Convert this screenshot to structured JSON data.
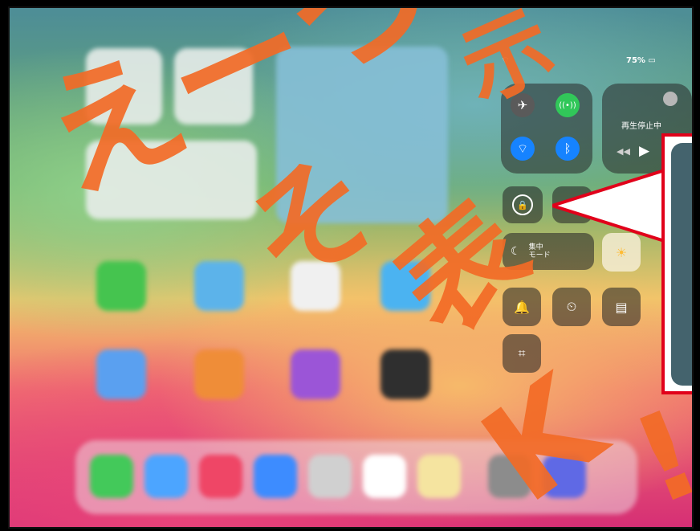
{
  "status_bar": {
    "battery": "75%"
  },
  "control_center": {
    "media_label": "再生停止中",
    "focus_label": "集中\nモード"
  },
  "watermark_text": [
    "えーつ",
    "そ",
    "表",
    "示",
    "K",
    "!"
  ],
  "colors": {
    "accent_red": "#e1001a",
    "wifi_blue": "#1683ff",
    "cellular_green": "#31c759",
    "watermark_orange": "#f26b26"
  }
}
